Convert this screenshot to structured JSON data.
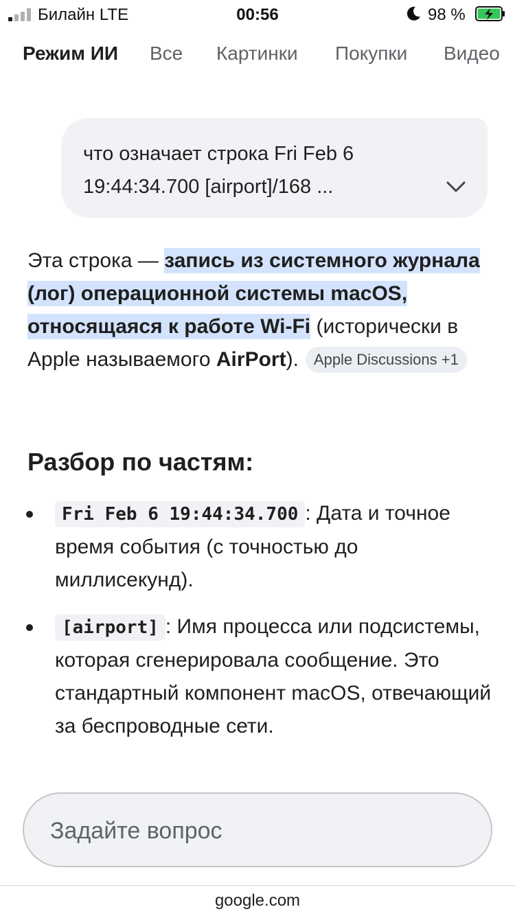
{
  "status_bar": {
    "carrier": "Билайн  LTE",
    "time": "00:56",
    "battery_percent": "98 %",
    "battery_color": "#34c759",
    "signal_bars_active": 1,
    "icons": [
      "signal-icon",
      "moon-icon",
      "battery-charging-icon"
    ]
  },
  "tabs": [
    "Режим ИИ",
    "Все",
    "Картинки",
    "Покупки",
    "Видео"
  ],
  "query": {
    "line1": "что означает строка Fri Feb 6",
    "line2": "19:44:34.700 [airport]/168 ..."
  },
  "answer": {
    "intro": "Эта строка — ",
    "highlight": "запись из системного журнала (лог) операционной системы macOS, относящаяся к работе Wi-Fi",
    "rest": " (исторически в Apple называемого ",
    "bold_term": "AirPort",
    "end": ").",
    "source_chip": "Apple Discussions +1",
    "highlight_color": "#d3e3fd"
  },
  "section": {
    "heading": "Разбор по частям:",
    "bullets": [
      {
        "code": "Fri Feb 6 19:44:34.700",
        "text": ": Дата и точное время события (с точностью до миллисекунд)."
      },
      {
        "code": "[airport]",
        "text": ": Имя процесса или подсистемы, которая сгенерировала сообщение. Это стандартный компонент macOS, отвечающий за беспроводные сети."
      }
    ]
  },
  "ask": {
    "placeholder": "Задайте вопрос"
  },
  "footer": {
    "domain": "google.com"
  }
}
